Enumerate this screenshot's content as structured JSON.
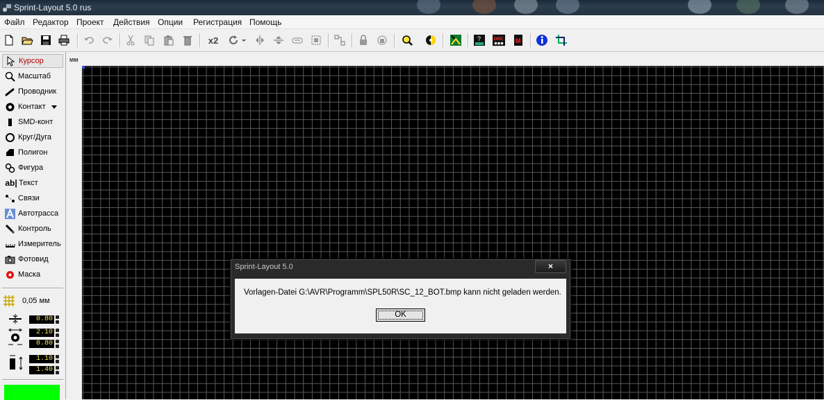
{
  "window": {
    "title": "Sprint-Layout 5.0 rus"
  },
  "menu": [
    "Файл",
    "Редактор",
    "Проект",
    "Действия",
    "Опции",
    "Регистрация",
    "Помощь"
  ],
  "toolbar": {
    "icons": [
      "new-file-icon",
      "open-folder-icon",
      "save-icon",
      "print-icon",
      "undo-icon",
      "redo-icon",
      "cut-icon",
      "copy-icon",
      "paste-icon",
      "delete-icon",
      "duplicate-x2-icon",
      "rotate-icon",
      "rotate-dropdown-icon",
      "mirror-horizontal-icon",
      "mirror-vertical-icon",
      "align-icon",
      "group-icon",
      "ungroup-icon",
      "lock-icon",
      "unlock-icon",
      "zoom-icon",
      "contrast-icon",
      "autoroute-icon",
      "test-icon",
      "drc-icon",
      "macro-icon",
      "info-icon",
      "crop-icon"
    ],
    "duplicate_label": "x2"
  },
  "tools": [
    {
      "label": "Курсор",
      "icon": "cursor-arrow-icon",
      "active": true
    },
    {
      "label": "Масштаб",
      "icon": "zoom-icon"
    },
    {
      "label": "Проводник",
      "icon": "track-icon"
    },
    {
      "label": "Контакт",
      "icon": "pad-icon",
      "dropdown": true
    },
    {
      "label": "SMD-конт",
      "icon": "smd-pad-icon"
    },
    {
      "label": "Круг/Дуга",
      "icon": "circle-arc-icon"
    },
    {
      "label": "Полигон",
      "icon": "polygon-icon"
    },
    {
      "label": "Фигура",
      "icon": "shape-icon"
    },
    {
      "label": "Текст",
      "icon": "text-icon"
    },
    {
      "label": "Связи",
      "icon": "connections-icon"
    },
    {
      "label": "Автотрасса",
      "icon": "autoroute-icon"
    },
    {
      "label": "Контроль",
      "icon": "test-icon"
    },
    {
      "label": "Измеритель",
      "icon": "measure-icon"
    },
    {
      "label": "Фотовид",
      "icon": "photoview-icon"
    },
    {
      "label": "Маска",
      "icon": "mask-icon"
    }
  ],
  "settings": {
    "grid": "0,05 мм",
    "track_width": "0.80",
    "pad_outer": "2.10",
    "pad_inner": "0.80",
    "smd_width": "1.10",
    "smd_height": "1.40",
    "layer_color": "#00ff00"
  },
  "ruler": {
    "unit": "мм"
  },
  "dialog": {
    "title": "Sprint-Layout 5.0",
    "close": "×",
    "message": "Vorlagen-Datei G:\\AVR\\Programm\\SPL50R\\SC_12_BOT.bmp kann nicht geladen werden.",
    "ok": "OK"
  }
}
